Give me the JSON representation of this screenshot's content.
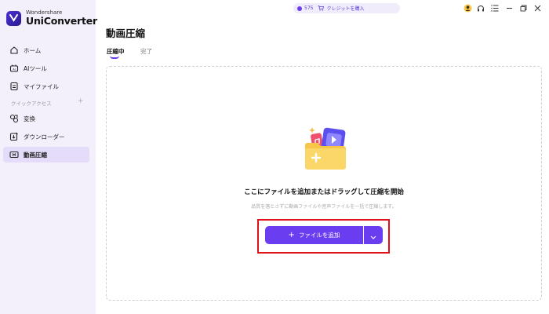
{
  "brand": {
    "company": "Wondershare",
    "product": "UniConverter"
  },
  "sidebar": {
    "items": [
      {
        "label": "ホーム"
      },
      {
        "label": "AIツール"
      },
      {
        "label": "マイファイル"
      },
      {
        "label": "変換"
      },
      {
        "label": "ダウンローダー"
      },
      {
        "label": "動画圧縮"
      }
    ],
    "section_label": "クイックアクセス",
    "section_add": "+"
  },
  "header": {
    "credits": "575",
    "buy_credits": "クレジットを購入"
  },
  "page": {
    "title": "動画圧縮",
    "tabs": [
      {
        "label": "圧縮中"
      },
      {
        "label": "完了"
      }
    ]
  },
  "dropzone": {
    "message": "ここにファイルを追加またはドラッグして圧縮を開始",
    "submessage": "品質を落とさずに動画ファイルや音声ファイルを一括で圧縮します。",
    "add_button_label": "ファイルを追加",
    "add_button_plus": "+"
  },
  "colors": {
    "accent": "#6a3df0",
    "highlight": "#e0111b",
    "sidebar_bg": "#f3f0fb"
  }
}
